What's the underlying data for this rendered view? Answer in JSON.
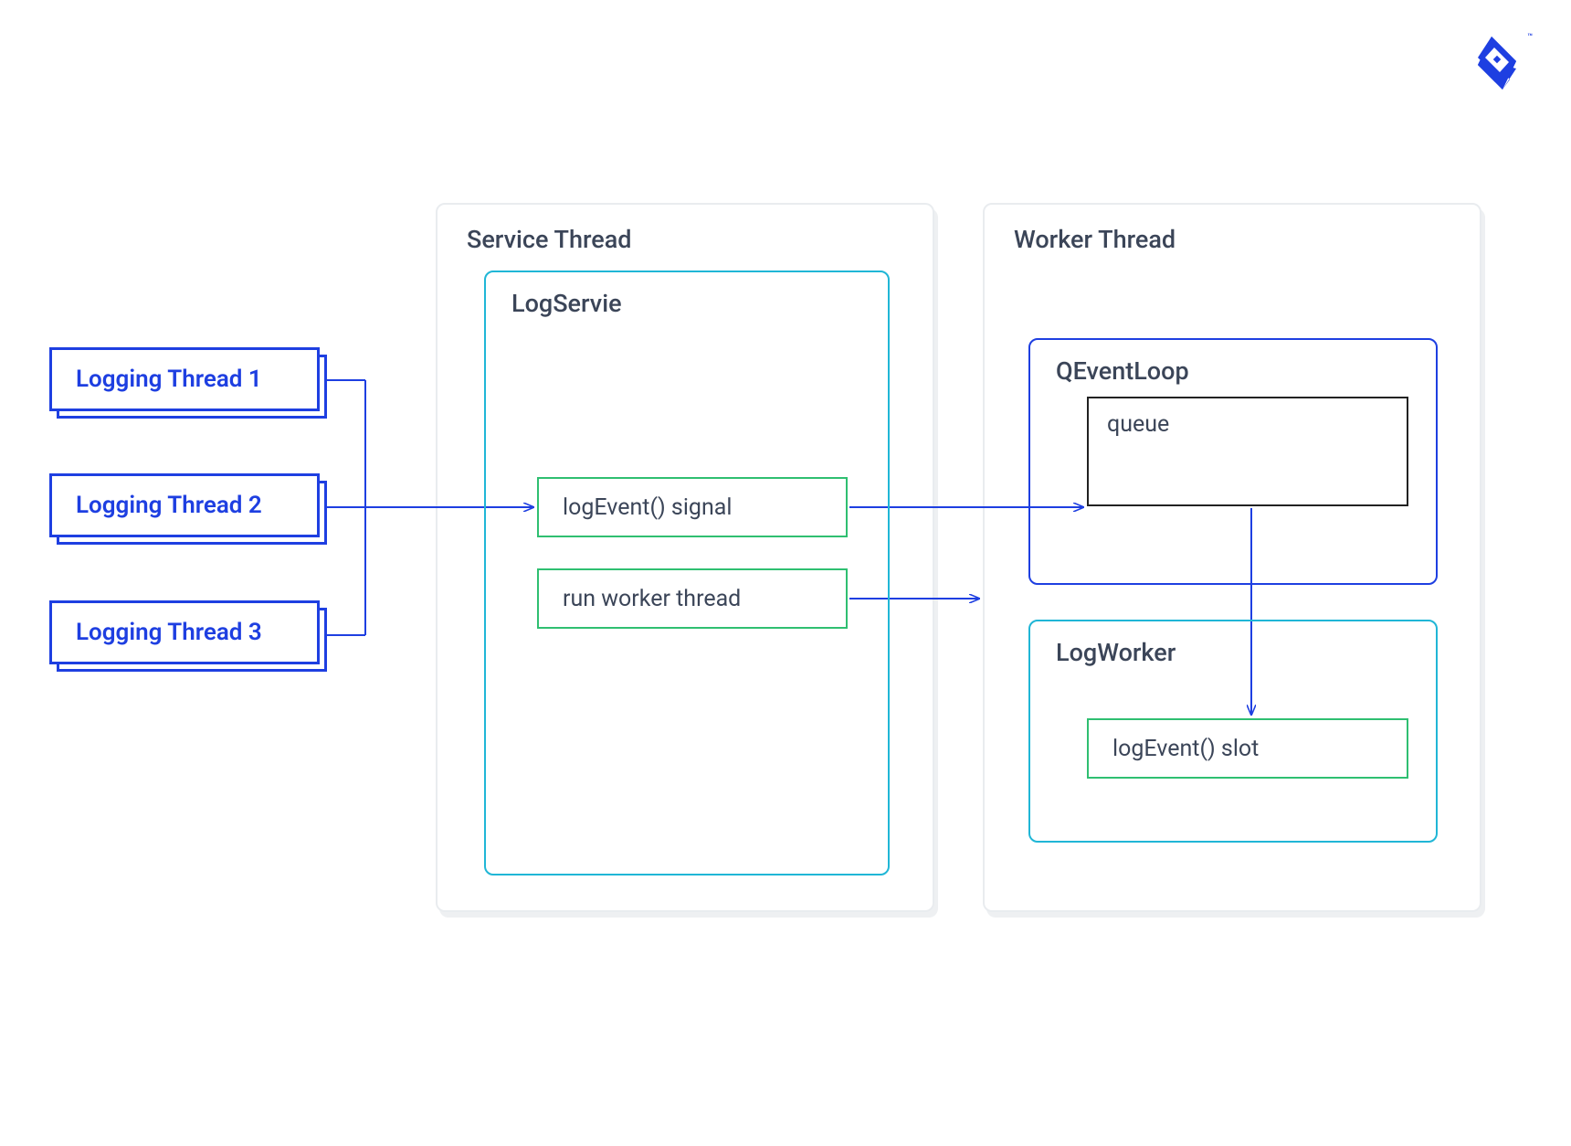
{
  "threads": {
    "t1": "Logging Thread 1",
    "t2": "Logging Thread 2",
    "t3": "Logging Thread 3"
  },
  "serviceThread": {
    "title": "Service Thread",
    "logService": {
      "title": "LogServie",
      "signal": "logEvent() signal",
      "run": "run worker thread"
    }
  },
  "workerThread": {
    "title": "Worker Thread",
    "eventLoop": {
      "title": "QEventLoop",
      "queue": "queue"
    },
    "logWorker": {
      "title": "LogWorker",
      "slot": "logEvent() slot"
    }
  },
  "colors": {
    "brandBlue": "#1E3FE1",
    "cyan": "#20b6d6",
    "green": "#2fbf71",
    "text": "#3b4558",
    "panelBorder": "#e9ecef"
  }
}
